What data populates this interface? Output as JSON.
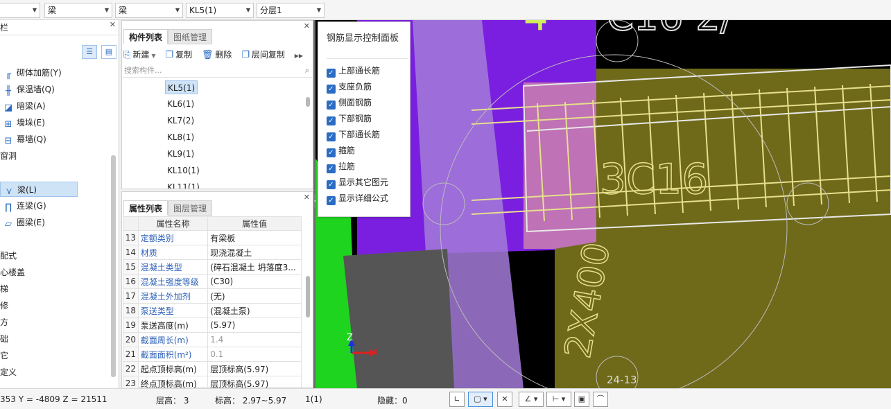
{
  "toolbar": {
    "combo1": "",
    "combo2": "梁",
    "combo3": "梁",
    "combo4": "KL5(1)",
    "combo5": "分层1"
  },
  "left_nav": {
    "header": "栏",
    "items": [
      {
        "label": "砌体加筋(Y)",
        "icon": "masonry-rebar-icon"
      },
      {
        "label": "保温墙(Q)",
        "icon": "insulation-wall-icon"
      },
      {
        "label": "暗梁(A)",
        "icon": "hidden-beam-icon"
      },
      {
        "label": "墙垛(E)",
        "icon": "wall-pier-icon"
      },
      {
        "label": "幕墙(Q)",
        "icon": "curtain-wall-icon"
      }
    ],
    "group_opening": "窗洞",
    "beam_items": [
      {
        "label": "梁(L)",
        "icon": "beam-icon",
        "selected": true
      },
      {
        "label": "连梁(G)",
        "icon": "link-beam-icon"
      },
      {
        "label": "圈梁(E)",
        "icon": "ring-beam-icon"
      }
    ],
    "groups": [
      "配式",
      "心楼盖",
      "梯",
      "修",
      "方",
      "础",
      "它",
      "定义"
    ]
  },
  "component_panel": {
    "tabs": [
      "构件列表",
      "图纸管理"
    ],
    "actions": [
      "新建",
      "复制",
      "删除",
      "层间复制"
    ],
    "search_placeholder": "搜索构件...",
    "items": [
      "KL5(1)",
      "KL6(1)",
      "KL7(2)",
      "KL8(1)",
      "KL9(1)",
      "KL10(1)",
      "KL11(1)"
    ],
    "selected": "KL5(1)"
  },
  "property_panel": {
    "tabs": [
      "属性列表",
      "图层管理"
    ],
    "col_name": "属性名称",
    "col_value": "属性值",
    "rows": [
      {
        "n": "13",
        "name": "定额类别",
        "value": "有梁板",
        "blue": true,
        "gray": false
      },
      {
        "n": "14",
        "name": "材质",
        "value": "现浇混凝土",
        "blue": true,
        "gray": false
      },
      {
        "n": "15",
        "name": "混凝土类型",
        "value": "(碎石混凝土 坍落度3...",
        "blue": true,
        "gray": false
      },
      {
        "n": "16",
        "name": "混凝土强度等级",
        "value": "(C30)",
        "blue": true,
        "gray": false
      },
      {
        "n": "17",
        "name": "混凝土外加剂",
        "value": "(无)",
        "blue": true,
        "gray": false
      },
      {
        "n": "18",
        "name": "泵送类型",
        "value": "(混凝土泵)",
        "blue": true,
        "gray": false
      },
      {
        "n": "19",
        "name": "泵送高度(m)",
        "value": "(5.97)",
        "blue": false,
        "gray": false
      },
      {
        "n": "20",
        "name": "截面周长(m)",
        "value": "1.4",
        "blue": true,
        "gray": true
      },
      {
        "n": "21",
        "name": "截面面积(m²)",
        "value": "0.1",
        "blue": true,
        "gray": true
      },
      {
        "n": "22",
        "name": "起点顶标高(m)",
        "value": "层顶标高(5.97)",
        "blue": false,
        "gray": false
      },
      {
        "n": "23",
        "name": "终点顶标高(m)",
        "value": "层顶标高(5.97)",
        "blue": false,
        "gray": false
      }
    ]
  },
  "rebar_panel": {
    "title": "钢筋显示控制面板",
    "options": [
      "上部通长筋",
      "支座负筋",
      "侧面钢筋",
      "下部钢筋",
      "下部通长筋",
      "箍筋",
      "拉筋",
      "显示其它图元",
      "显示详细公式"
    ]
  },
  "viewport": {
    "beam_label": "3C16",
    "size_label": "2X400",
    "bottom_label": "24-13",
    "axis_x": "X",
    "axis_z": "Z",
    "colors": {
      "purple": "#7a1fe0",
      "olive": "#6f6a1a",
      "green": "#1fd41f",
      "lavender": "#a37bd8",
      "rebar": "#e6e08c"
    }
  },
  "status": {
    "coords": "353 Y = -4809 Z = 21511",
    "floor_height": "层高： 3",
    "elevation": "标高： 2.97~5.97",
    "count": "1(1)",
    "hidden": "隐藏：0"
  }
}
